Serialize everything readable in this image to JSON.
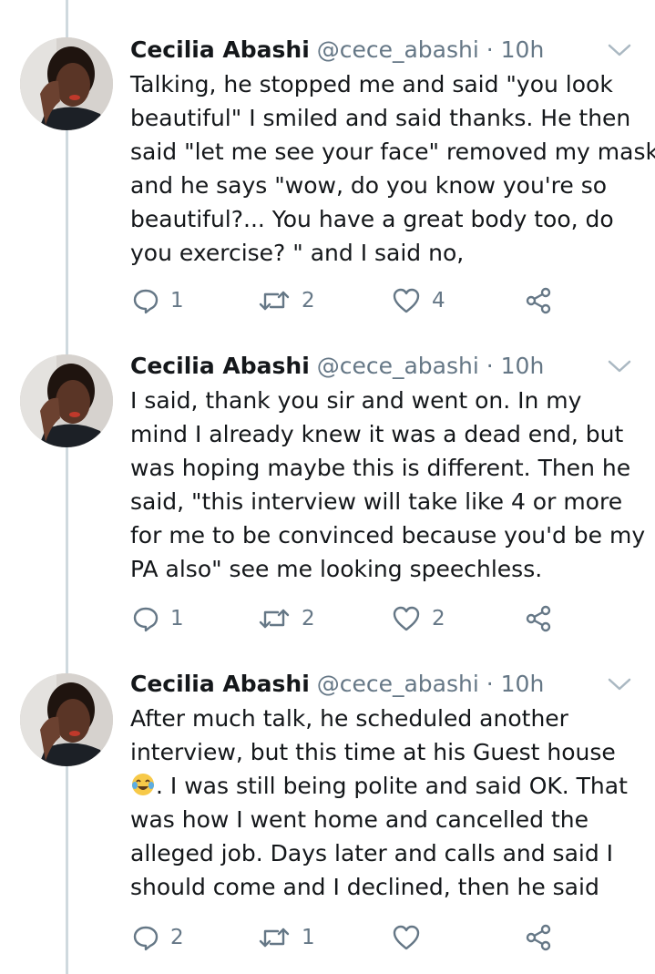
{
  "tweets": [
    {
      "name": "Cecilia Abashi",
      "handle": "@cece_abashi",
      "separator": "·",
      "time": "10h",
      "lines": [
        "Talking,  he stopped me and said \"you look",
        "beautiful\" I smiled and said thanks.  He then",
        "said \"let me see your face\" removed my mask",
        "and he says \"wow,  do you know you're so",
        "beautiful?...  You have a great body too,  do",
        "you exercise? \" and I said no,"
      ],
      "replies": "1",
      "retweets": "2",
      "likes": "4"
    },
    {
      "name": "Cecilia Abashi",
      "handle": "@cece_abashi",
      "separator": "·",
      "time": "10h",
      "lines": [
        "I said,  thank you sir and went on.  In my",
        "mind I already knew it was a dead end,  but",
        "was hoping maybe this is different.  Then he",
        "said,  \"this interview will take like 4 or more",
        "for me to be convinced because you'd be my",
        "PA also\" see me looking speechless."
      ],
      "replies": "1",
      "retweets": "2",
      "likes": "2"
    },
    {
      "name": "Cecilia Abashi",
      "handle": "@cece_abashi",
      "separator": "·",
      "time": "10h",
      "lines": [
        "After much talk,  he scheduled another",
        "interview,  but this time at his Guest house",
        ".  I was still being polite and said OK. That",
        "was how I went home and cancelled the",
        "alleged job.  Days later and calls and said I",
        "should come and I declined, then he said"
      ],
      "replies": "2",
      "retweets": "1",
      "likes": ""
    }
  ],
  "icons": {
    "reply": "reply-icon",
    "retweet": "retweet-icon",
    "like": "heart-icon",
    "share": "share-icon",
    "caret": "chevron-down-icon",
    "emoji": "tears-of-joy-emoji"
  },
  "colors": {
    "text": "#14171a",
    "secondary": "#657786",
    "thread_line": "#cfd9de"
  }
}
